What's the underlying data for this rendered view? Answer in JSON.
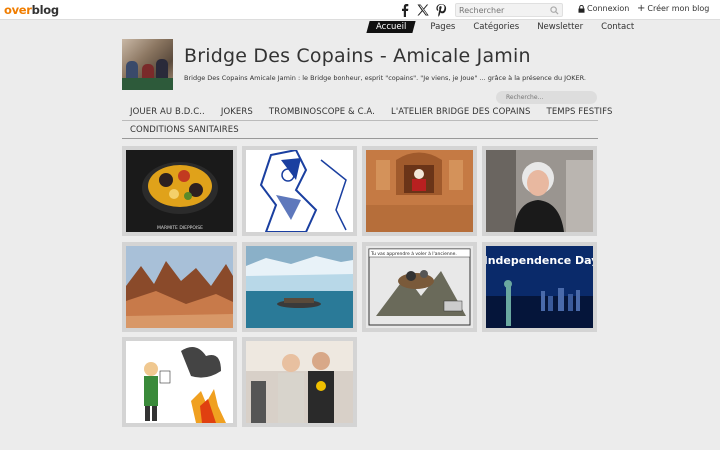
{
  "topbar": {
    "logo_part1": "over",
    "logo_part2": "blog",
    "search_placeholder": "Rechercher",
    "connexion_label": "Connexion",
    "create_label": "Créer mon blog"
  },
  "nav": {
    "items": [
      {
        "label": "Accueil"
      },
      {
        "label": "Pages"
      },
      {
        "label": "Catégories"
      },
      {
        "label": "Newsletter"
      },
      {
        "label": "Contact"
      }
    ]
  },
  "header": {
    "title": "Bridge Des Copains - Amicale Jamin",
    "description": "Bridge Des Copains Amicale Jamin : le Bridge bonheur, esprit \"copains\". \"Je viens, je Joue\" ... grâce à la présence du JOKER.",
    "search_placeholder": "Recherche..."
  },
  "menu": {
    "items": [
      {
        "label": "JOUER AU B.D.C.."
      },
      {
        "label": "JOKERS"
      },
      {
        "label": "TROMBINOSCOPE & C.A."
      },
      {
        "label": "L'ATELIER BRIDGE DES COPAINS"
      },
      {
        "label": "TEMPS FESTIFS"
      },
      {
        "label": "CONDITIONS SANITAIRES"
      }
    ]
  },
  "articles": {
    "thumb_texts": {
      "marmite": "MARMITE DIEPPOISE",
      "cartoon_caption": "Tu vas apprendre à voler à l'ancienne.",
      "independence": "Independence Day"
    }
  },
  "colors": {
    "background": "#ececec",
    "brand_orange": "#f07d00",
    "nav_active_bg": "#111111"
  },
  "icons": [
    "facebook-icon",
    "x-twitter-icon",
    "pinterest-icon",
    "search-icon",
    "lock-icon",
    "plus-icon"
  ]
}
